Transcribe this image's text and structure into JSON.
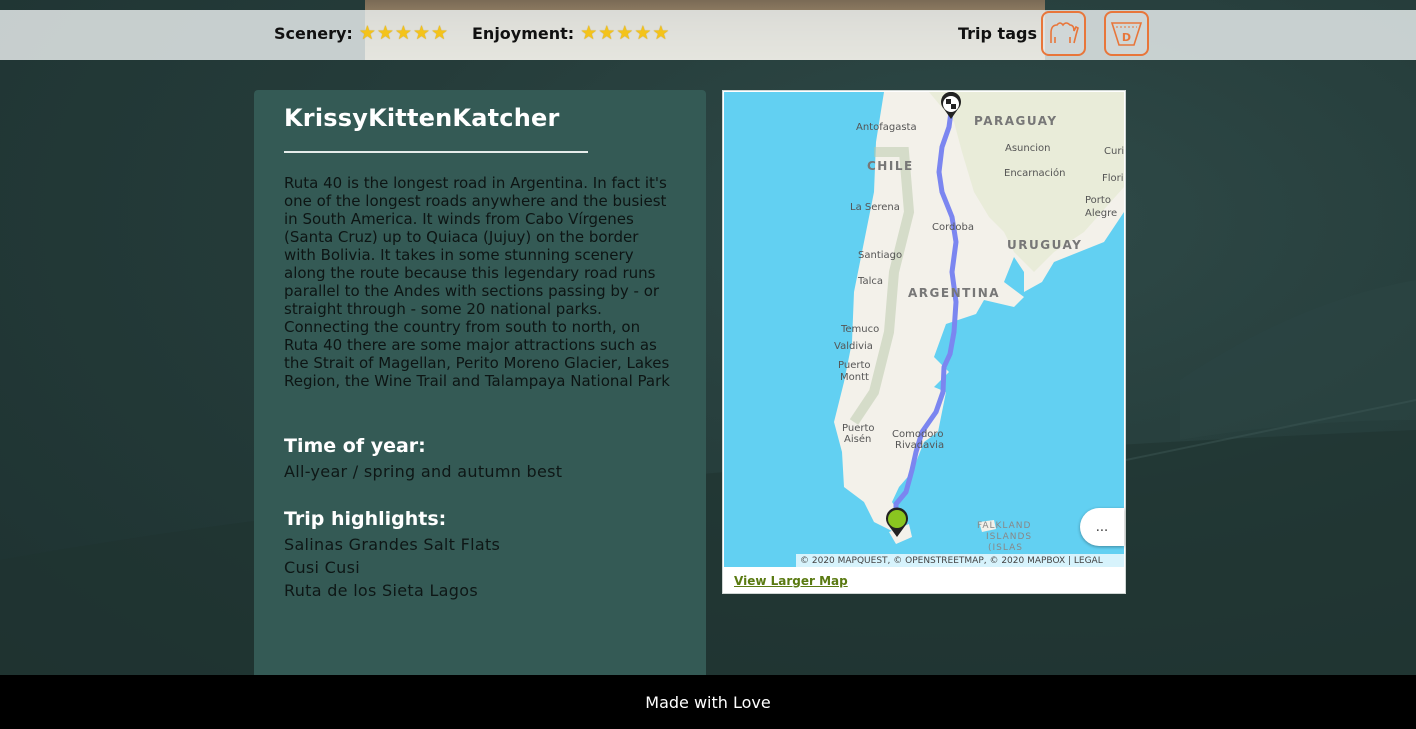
{
  "ratings": {
    "scenery": {
      "label": "Scenery:",
      "stars": 5
    },
    "enjoyment": {
      "label": "Enjoyment:",
      "stars": 5
    }
  },
  "trip_tags": {
    "label": "Trip tags",
    "icons": [
      "camel-icon",
      "speedometer-icon"
    ],
    "accent_color": "#e8763a"
  },
  "post": {
    "username": "KrissyKittenKatcher",
    "description": "Ruta 40 is the longest road in Argentina. In fact it's one of the longest roads anywhere and the busiest in South America. It winds from Cabo Vírgenes (Santa Cruz) up to Quiaca (Jujuy) on the border with Bolivia. It takes in some stunning scenery along the route because this legendary road runs parallel to the Andes with sections passing by - or straight through - some 20 national parks. Connecting the country from south to north, on Ruta 40 there are some major attractions such as the Strait of Magellan, Perito Moreno Glacier, Lakes Region, the Wine Trail and Talampaya National Park",
    "time_of_year_label": "Time of year:",
    "time_of_year": "All-year / spring and autumn best",
    "highlights_label": "Trip highlights:",
    "highlights": [
      "Salinas Grandes Salt Flats",
      "Cusi Cusi",
      "Ruta de los Sieta Lagos"
    ]
  },
  "map": {
    "labels": {
      "antofagasta": "Antofagasta",
      "paraguay": "PARAGUAY",
      "asuncion": "Asuncion",
      "curitiba": "Curi",
      "chile": "CHILE",
      "encarnacion": "Encarnación",
      "florianopolis": "Floria",
      "porto_alegre": "Porto\nAlegre",
      "la_serena": "La Serena",
      "cordoba": "Cordoba",
      "uruguay": "URUGUAY",
      "santiago": "Santiago",
      "talca": "Talca",
      "argentina": "ARGENTINA",
      "temuco": "Temuco",
      "valdivia": "Valdivia",
      "puerto_montt": "Puerto\nMontt",
      "comodoro": "Comodoro\nRivadavia",
      "puerto_aisen": "Puerto\nAisén",
      "falkland": "FALKLAND\nISLANDS\n(ISLAS"
    },
    "attribution": "© 2020 MAPQUEST, © OPENSTREETMAP, © 2020 MAPBOX | LEGAL",
    "more_button": "...",
    "view_larger": "View Larger Map",
    "colors": {
      "water": "#62d0f2",
      "land": "#f3f1ea",
      "route": "#7b86f0"
    }
  },
  "footer": {
    "text": "Made with Love"
  }
}
